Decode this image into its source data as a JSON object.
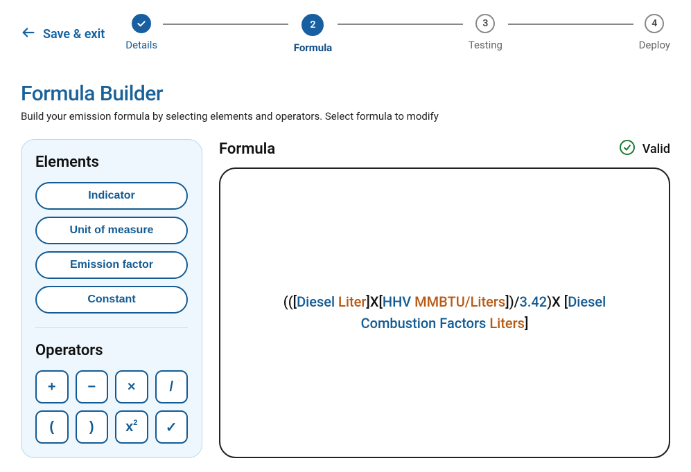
{
  "header": {
    "save_label": "Save & exit",
    "steps": [
      {
        "label": "Details",
        "status": "done",
        "number": "1"
      },
      {
        "label": "Formula",
        "status": "active",
        "number": "2"
      },
      {
        "label": "Testing",
        "status": "pending",
        "number": "3"
      },
      {
        "label": "Deploy",
        "status": "pending",
        "number": "4"
      }
    ]
  },
  "page": {
    "title": "Formula Builder",
    "subtitle": "Build your emission formula by selecting elements and operators. Select formula to modify"
  },
  "elements": {
    "heading": "Elements",
    "buttons": [
      {
        "label": "Indicator"
      },
      {
        "label": "Unit of measure"
      },
      {
        "label": "Emission factor"
      },
      {
        "label": "Constant"
      }
    ]
  },
  "operators": {
    "heading": "Operators",
    "buttons": [
      {
        "glyph": "+",
        "name": "plus"
      },
      {
        "glyph": "−",
        "name": "minus"
      },
      {
        "glyph": "×",
        "name": "multiply"
      },
      {
        "glyph": "/",
        "name": "divide"
      },
      {
        "glyph": "(",
        "name": "open-paren"
      },
      {
        "glyph": ")",
        "name": "close-paren"
      },
      {
        "glyph": "x²",
        "name": "power"
      },
      {
        "glyph": "✓",
        "name": "check"
      }
    ]
  },
  "formula_panel": {
    "heading": "Formula",
    "status_label": "Valid",
    "status_icon": "check-circle"
  },
  "formula": {
    "tokens": [
      {
        "type": "punct",
        "text": "(("
      },
      {
        "type": "punct",
        "text": "["
      },
      {
        "type": "name",
        "text": "Diesel "
      },
      {
        "type": "unit",
        "text": "Liter"
      },
      {
        "type": "punct",
        "text": "]"
      },
      {
        "type": "op",
        "text": "X"
      },
      {
        "type": "punct",
        "text": "["
      },
      {
        "type": "name",
        "text": "HHV "
      },
      {
        "type": "unit",
        "text": "MMBTU/Liters"
      },
      {
        "type": "punct",
        "text": "]"
      },
      {
        "type": "punct",
        "text": ")"
      },
      {
        "type": "op",
        "text": "/"
      },
      {
        "type": "name",
        "text": "3.42"
      },
      {
        "type": "punct",
        "text": ")"
      },
      {
        "type": "op",
        "text": "X "
      },
      {
        "type": "punct",
        "text": "["
      },
      {
        "type": "name",
        "text": "Diesel Combustion Factors "
      },
      {
        "type": "unit",
        "text": "Liters"
      },
      {
        "type": "punct",
        "text": "]"
      }
    ]
  }
}
